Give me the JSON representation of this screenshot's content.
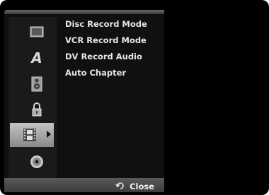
{
  "menu": {
    "options": [
      {
        "label": "Disc Record Mode"
      },
      {
        "label": "VCR Record Mode"
      },
      {
        "label": "DV Record Audio"
      },
      {
        "label": "Auto Chapter"
      }
    ],
    "sidebar": [
      {
        "icon": "monitor-icon"
      },
      {
        "icon": "language-icon",
        "glyph": "A"
      },
      {
        "icon": "speaker-icon"
      },
      {
        "icon": "lock-icon"
      },
      {
        "icon": "film-record-icon",
        "active": true
      },
      {
        "icon": "disc-icon"
      }
    ]
  },
  "footer": {
    "close_label": "Close",
    "close_icon": "return-icon"
  },
  "colors": {
    "background": "#000000",
    "panel": "#101010",
    "active_item": "#b0b0b0",
    "text": "#e6e6e6"
  }
}
